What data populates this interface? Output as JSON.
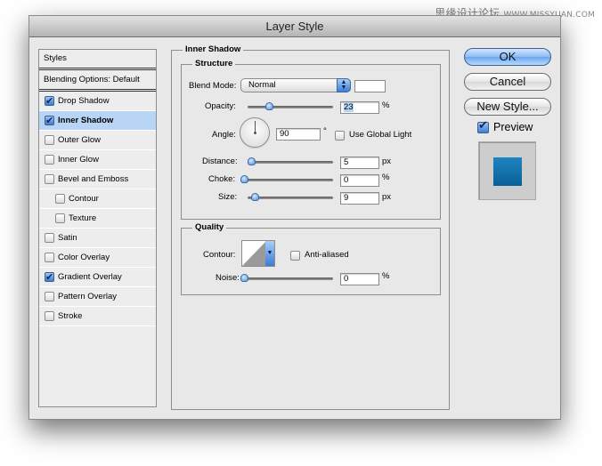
{
  "watermark": {
    "cn": "思缘设计论坛",
    "url": "WWW.MISSYUAN.COM"
  },
  "window": {
    "title": "Layer Style"
  },
  "styles_panel": {
    "header": "Styles",
    "blending": "Blending Options: Default",
    "items": [
      {
        "label": "Drop Shadow",
        "checked": true,
        "selected": false,
        "sub": false
      },
      {
        "label": "Inner Shadow",
        "checked": true,
        "selected": true,
        "sub": false
      },
      {
        "label": "Outer Glow",
        "checked": false,
        "selected": false,
        "sub": false
      },
      {
        "label": "Inner Glow",
        "checked": false,
        "selected": false,
        "sub": false
      },
      {
        "label": "Bevel and Emboss",
        "checked": false,
        "selected": false,
        "sub": false
      },
      {
        "label": "Contour",
        "checked": false,
        "selected": false,
        "sub": true
      },
      {
        "label": "Texture",
        "checked": false,
        "selected": false,
        "sub": true
      },
      {
        "label": "Satin",
        "checked": false,
        "selected": false,
        "sub": false
      },
      {
        "label": "Color Overlay",
        "checked": false,
        "selected": false,
        "sub": false
      },
      {
        "label": "Gradient Overlay",
        "checked": true,
        "selected": false,
        "sub": false
      },
      {
        "label": "Pattern Overlay",
        "checked": false,
        "selected": false,
        "sub": false
      },
      {
        "label": "Stroke",
        "checked": false,
        "selected": false,
        "sub": false
      }
    ]
  },
  "inner_shadow": {
    "title": "Inner Shadow",
    "structure": {
      "title": "Structure",
      "blend_mode_label": "Blend Mode:",
      "blend_mode_value": "Normal",
      "shadow_color": "#ffffff",
      "opacity_label": "Opacity:",
      "opacity_value": "23",
      "opacity_unit": "%",
      "opacity_fraction": 0.23,
      "angle_label": "Angle:",
      "angle_value": "90",
      "angle_unit": "°",
      "use_global_light_label": "Use Global Light",
      "use_global_light": false,
      "distance_label": "Distance:",
      "distance_value": "5",
      "distance_unit": "px",
      "distance_fraction": 0.02,
      "choke_label": "Choke:",
      "choke_value": "0",
      "choke_unit": "%",
      "choke_fraction": 0.0,
      "size_label": "Size:",
      "size_value": "9",
      "size_unit": "px",
      "size_fraction": 0.04
    },
    "quality": {
      "title": "Quality",
      "contour_label": "Contour:",
      "anti_aliased_label": "Anti-aliased",
      "anti_aliased": false,
      "noise_label": "Noise:",
      "noise_value": "0",
      "noise_unit": "%",
      "noise_fraction": 0.0
    }
  },
  "buttons": {
    "ok": "OK",
    "cancel": "Cancel",
    "new_style": "New Style..."
  },
  "preview": {
    "label": "Preview",
    "checked": true,
    "swatch_color": "#0f6ba6"
  }
}
